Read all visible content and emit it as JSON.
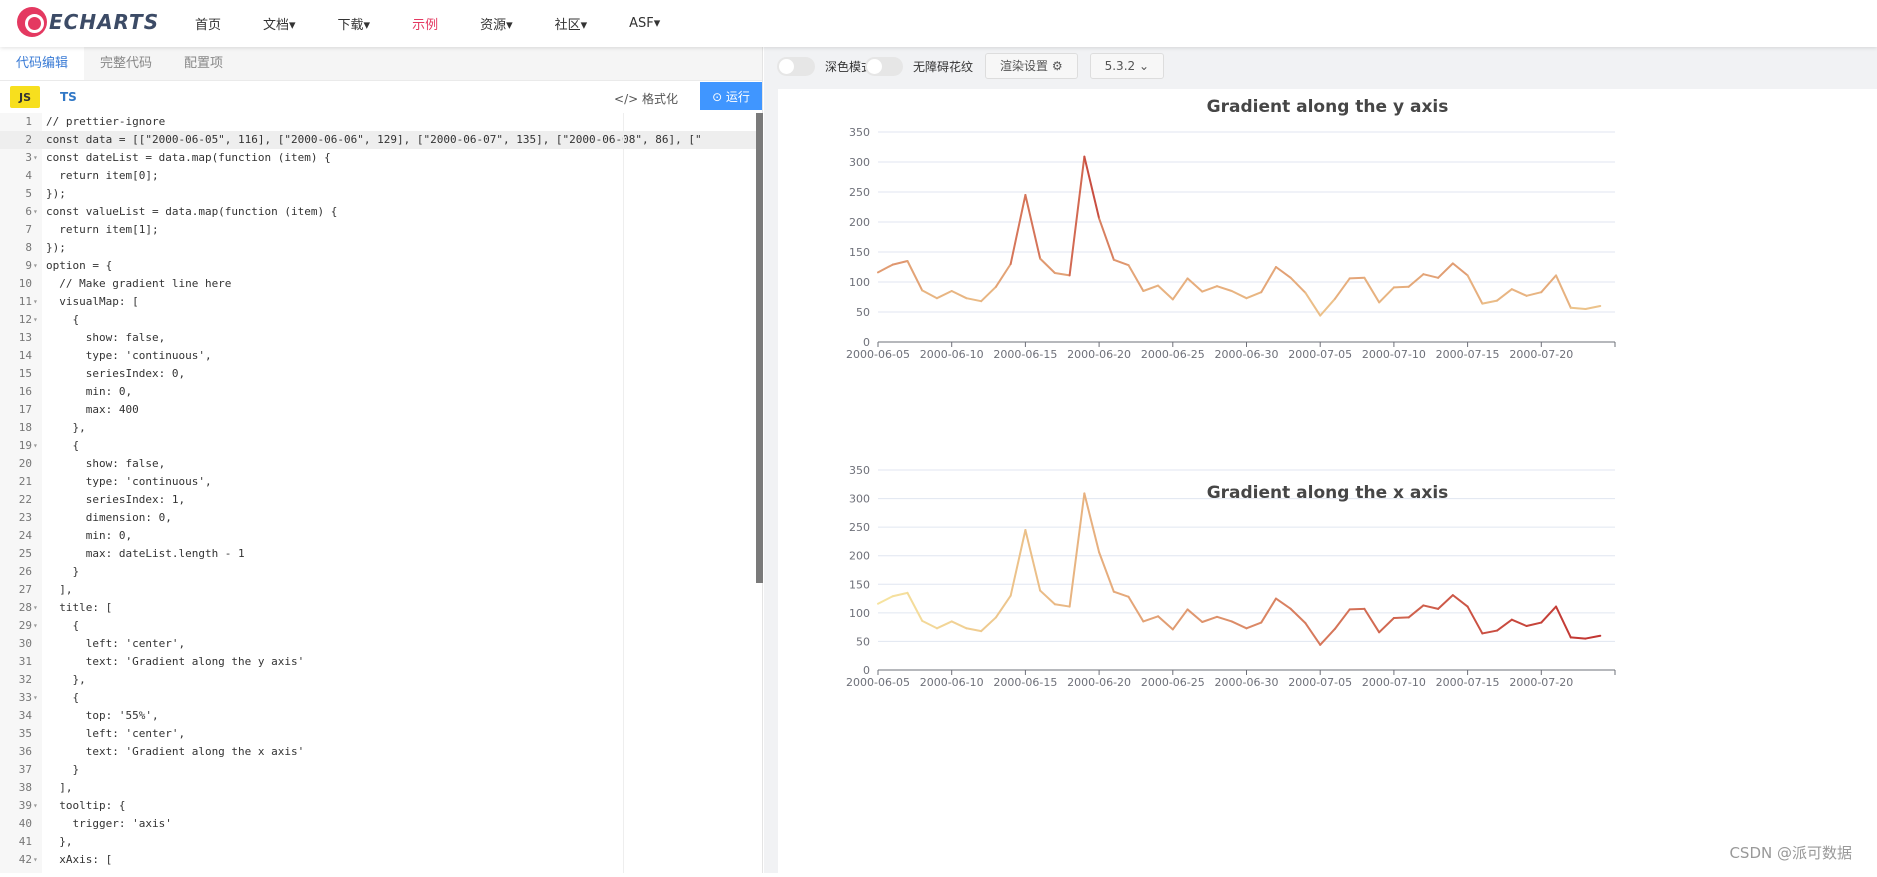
{
  "nav": {
    "logo_text": "ECHARTS",
    "items": [
      "首页",
      "文档▾",
      "下载▾",
      "示例",
      "资源▾",
      "社区▾",
      "ASF▾"
    ],
    "active_index": 3
  },
  "editor": {
    "tabs": [
      "代码编辑",
      "完整代码",
      "配置项"
    ],
    "lang_js": "JS",
    "lang_ts": "TS",
    "format_label": "</> 格式化",
    "run_label": "⊙ 运行",
    "lines": [
      {
        "n": "1",
        "f": "",
        "t": "// prettier-ignore"
      },
      {
        "n": "2",
        "f": "",
        "t": "const data = [[\"2000-06-05\", 116], [\"2000-06-06\", 129], [\"2000-06-07\", 135], [\"2000-06-08\", 86], [\""
      },
      {
        "n": "3",
        "f": "▾",
        "t": "const dateList = data.map(function (item) {"
      },
      {
        "n": "4",
        "f": "",
        "t": "  return item[0];"
      },
      {
        "n": "5",
        "f": "",
        "t": "});"
      },
      {
        "n": "6",
        "f": "▾",
        "t": "const valueList = data.map(function (item) {"
      },
      {
        "n": "7",
        "f": "",
        "t": "  return item[1];"
      },
      {
        "n": "8",
        "f": "",
        "t": "});"
      },
      {
        "n": "9",
        "f": "▾",
        "t": "option = {"
      },
      {
        "n": "10",
        "f": "",
        "t": "  // Make gradient line here"
      },
      {
        "n": "11",
        "f": "▾",
        "t": "  visualMap: ["
      },
      {
        "n": "12",
        "f": "▾",
        "t": "    {"
      },
      {
        "n": "13",
        "f": "",
        "t": "      show: false,"
      },
      {
        "n": "14",
        "f": "",
        "t": "      type: 'continuous',"
      },
      {
        "n": "15",
        "f": "",
        "t": "      seriesIndex: 0,"
      },
      {
        "n": "16",
        "f": "",
        "t": "      min: 0,"
      },
      {
        "n": "17",
        "f": "",
        "t": "      max: 400"
      },
      {
        "n": "18",
        "f": "",
        "t": "    },"
      },
      {
        "n": "19",
        "f": "▾",
        "t": "    {"
      },
      {
        "n": "20",
        "f": "",
        "t": "      show: false,"
      },
      {
        "n": "21",
        "f": "",
        "t": "      type: 'continuous',"
      },
      {
        "n": "22",
        "f": "",
        "t": "      seriesIndex: 1,"
      },
      {
        "n": "23",
        "f": "",
        "t": "      dimension: 0,"
      },
      {
        "n": "24",
        "f": "",
        "t": "      min: 0,"
      },
      {
        "n": "25",
        "f": "",
        "t": "      max: dateList.length - 1"
      },
      {
        "n": "26",
        "f": "",
        "t": "    }"
      },
      {
        "n": "27",
        "f": "",
        "t": "  ],"
      },
      {
        "n": "28",
        "f": "▾",
        "t": "  title: ["
      },
      {
        "n": "29",
        "f": "▾",
        "t": "    {"
      },
      {
        "n": "30",
        "f": "",
        "t": "      left: 'center',"
      },
      {
        "n": "31",
        "f": "",
        "t": "      text: 'Gradient along the y axis'"
      },
      {
        "n": "32",
        "f": "",
        "t": "    },"
      },
      {
        "n": "33",
        "f": "▾",
        "t": "    {"
      },
      {
        "n": "34",
        "f": "",
        "t": "      top: '55%',"
      },
      {
        "n": "35",
        "f": "",
        "t": "      left: 'center',"
      },
      {
        "n": "36",
        "f": "",
        "t": "      text: 'Gradient along the x axis'"
      },
      {
        "n": "37",
        "f": "",
        "t": "    }"
      },
      {
        "n": "38",
        "f": "",
        "t": "  ],"
      },
      {
        "n": "39",
        "f": "▾",
        "t": "  tooltip: {"
      },
      {
        "n": "40",
        "f": "",
        "t": "    trigger: 'axis'"
      },
      {
        "n": "41",
        "f": "",
        "t": "  },"
      },
      {
        "n": "42",
        "f": "▾",
        "t": "  xAxis: ["
      }
    ]
  },
  "preview_toolbar": {
    "dark_mode_label": "深色模式",
    "decal_label": "无障碍花纹",
    "render_settings_label": "渲染设置 ⚙",
    "version_label": "5.3.2  ⌄"
  },
  "watermark": "CSDN @派可数据",
  "chart_data": [
    {
      "type": "line",
      "title": "Gradient along the y axis",
      "ylim": [
        0,
        350
      ],
      "yticks": [
        0,
        50,
        100,
        150,
        200,
        250,
        300,
        350
      ],
      "xtick_labels": [
        "2000-06-05",
        "2000-06-10",
        "2000-06-15",
        "2000-06-20",
        "2000-06-25",
        "2000-06-30",
        "2000-07-05",
        "2000-07-10",
        "2000-07-15",
        "2000-07-20"
      ],
      "gradient": "by value (low = #f6e39f, high = #c23531)",
      "x": [
        "2000-06-05",
        "2000-06-06",
        "2000-06-07",
        "2000-06-08",
        "2000-06-09",
        "2000-06-10",
        "2000-06-11",
        "2000-06-12",
        "2000-06-13",
        "2000-06-14",
        "2000-06-15",
        "2000-06-16",
        "2000-06-17",
        "2000-06-18",
        "2000-06-19",
        "2000-06-20",
        "2000-06-21",
        "2000-06-22",
        "2000-06-23",
        "2000-06-24",
        "2000-06-25",
        "2000-06-26",
        "2000-06-27",
        "2000-06-28",
        "2000-06-29",
        "2000-06-30",
        "2000-07-01",
        "2000-07-02",
        "2000-07-03",
        "2000-07-04",
        "2000-07-05",
        "2000-07-06",
        "2000-07-07",
        "2000-07-08",
        "2000-07-09",
        "2000-07-10",
        "2000-07-11",
        "2000-07-12",
        "2000-07-13",
        "2000-07-14",
        "2000-07-15",
        "2000-07-16",
        "2000-07-17",
        "2000-07-18",
        "2000-07-19",
        "2000-07-20",
        "2000-07-21",
        "2000-07-22",
        "2000-07-23",
        "2000-07-24",
        "2000-07-25"
      ],
      "values": [
        116,
        129,
        135,
        86,
        73,
        85,
        73,
        68,
        92,
        130,
        245,
        139,
        115,
        111,
        309,
        206,
        137,
        128,
        85,
        94,
        71,
        106,
        84,
        93,
        85,
        73,
        83,
        125,
        107,
        82,
        44,
        72,
        106,
        107,
        66,
        91,
        92,
        113,
        107,
        131,
        111,
        64,
        69,
        88,
        77,
        83,
        111,
        57,
        55,
        60
      ]
    },
    {
      "type": "line",
      "title": "Gradient along the x axis",
      "ylim": [
        0,
        350
      ],
      "yticks": [
        0,
        50,
        100,
        150,
        200,
        250,
        300,
        350
      ],
      "xtick_labels": [
        "2000-06-05",
        "2000-06-10",
        "2000-06-15",
        "2000-06-20",
        "2000-06-25",
        "2000-06-30",
        "2000-07-05",
        "2000-07-10",
        "2000-07-15",
        "2000-07-20"
      ],
      "gradient": "by x index (left = #f6e39f, right = #c23531)",
      "x": [
        "2000-06-05",
        "2000-06-06",
        "2000-06-07",
        "2000-06-08",
        "2000-06-09",
        "2000-06-10",
        "2000-06-11",
        "2000-06-12",
        "2000-06-13",
        "2000-06-14",
        "2000-06-15",
        "2000-06-16",
        "2000-06-17",
        "2000-06-18",
        "2000-06-19",
        "2000-06-20",
        "2000-06-21",
        "2000-06-22",
        "2000-06-23",
        "2000-06-24",
        "2000-06-25",
        "2000-06-26",
        "2000-06-27",
        "2000-06-28",
        "2000-06-29",
        "2000-06-30",
        "2000-07-01",
        "2000-07-02",
        "2000-07-03",
        "2000-07-04",
        "2000-07-05",
        "2000-07-06",
        "2000-07-07",
        "2000-07-08",
        "2000-07-09",
        "2000-07-10",
        "2000-07-11",
        "2000-07-12",
        "2000-07-13",
        "2000-07-14",
        "2000-07-15",
        "2000-07-16",
        "2000-07-17",
        "2000-07-18",
        "2000-07-19",
        "2000-07-20",
        "2000-07-21",
        "2000-07-22",
        "2000-07-23",
        "2000-07-24",
        "2000-07-25"
      ],
      "values": [
        116,
        129,
        135,
        86,
        73,
        85,
        73,
        68,
        92,
        130,
        245,
        139,
        115,
        111,
        309,
        206,
        137,
        128,
        85,
        94,
        71,
        106,
        84,
        93,
        85,
        73,
        83,
        125,
        107,
        82,
        44,
        72,
        106,
        107,
        66,
        91,
        92,
        113,
        107,
        131,
        111,
        64,
        69,
        88,
        77,
        83,
        111,
        57,
        55,
        60
      ]
    }
  ]
}
